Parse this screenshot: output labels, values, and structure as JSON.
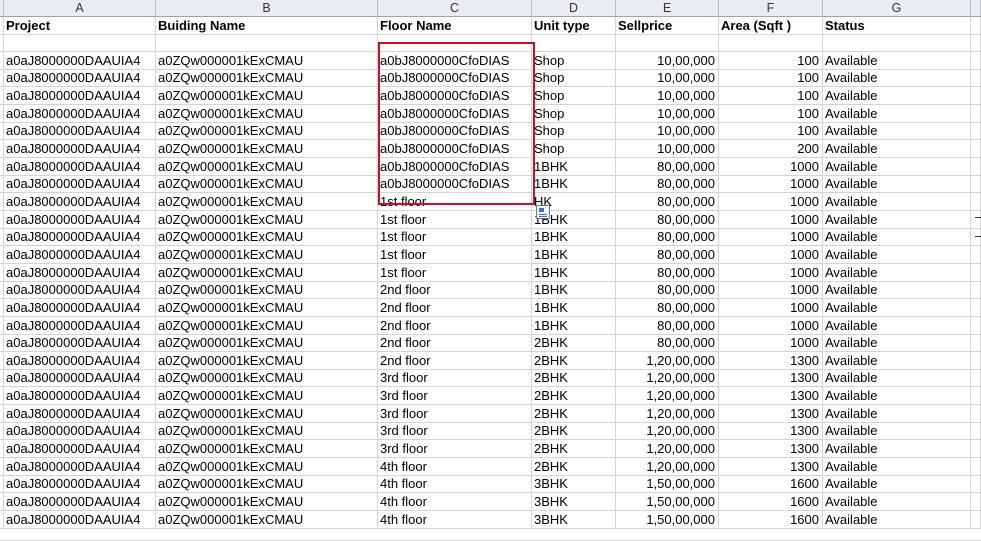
{
  "columns": [
    "A",
    "B",
    "C",
    "D",
    "E",
    "F",
    "G"
  ],
  "headers": [
    "Project",
    "Buiding Name",
    "Floor Name",
    "Unit type",
    "Sellprice",
    "Area (Sqft )",
    "Status"
  ],
  "rows": [
    [
      "a0aJ8000000DAAUIA4",
      "a0ZQw000001kExCMAU",
      "a0bJ8000000CfoDIAS",
      "Shop",
      "10,00,000",
      "100",
      "Available"
    ],
    [
      "a0aJ8000000DAAUIA4",
      "a0ZQw000001kExCMAU",
      "a0bJ8000000CfoDIAS",
      "Shop",
      "10,00,000",
      "100",
      "Available"
    ],
    [
      "a0aJ8000000DAAUIA4",
      "a0ZQw000001kExCMAU",
      "a0bJ8000000CfoDIAS",
      "Shop",
      "10,00,000",
      "100",
      "Available"
    ],
    [
      "a0aJ8000000DAAUIA4",
      "a0ZQw000001kExCMAU",
      "a0bJ8000000CfoDIAS",
      "Shop",
      "10,00,000",
      "100",
      "Available"
    ],
    [
      "a0aJ8000000DAAUIA4",
      "a0ZQw000001kExCMAU",
      "a0bJ8000000CfoDIAS",
      "Shop",
      "10,00,000",
      "100",
      "Available"
    ],
    [
      "a0aJ8000000DAAUIA4",
      "a0ZQw000001kExCMAU",
      "a0bJ8000000CfoDIAS",
      "Shop",
      "10,00,000",
      "200",
      "Available"
    ],
    [
      "a0aJ8000000DAAUIA4",
      "a0ZQw000001kExCMAU",
      "a0bJ8000000CfoDIAS",
      "1BHK",
      "80,00,000",
      "1000",
      "Available"
    ],
    [
      "a0aJ8000000DAAUIA4",
      "a0ZQw000001kExCMAU",
      "a0bJ8000000CfoDIAS",
      "1BHK",
      "80,00,000",
      "1000",
      "Available"
    ],
    [
      "a0aJ8000000DAAUIA4",
      "a0ZQw000001kExCMAU",
      "1st floor",
      "HK",
      "80,00,000",
      "1000",
      "Available"
    ],
    [
      "a0aJ8000000DAAUIA4",
      "a0ZQw000001kExCMAU",
      "1st floor",
      "1BHK",
      "80,00,000",
      "1000",
      "Available"
    ],
    [
      "a0aJ8000000DAAUIA4",
      "a0ZQw000001kExCMAU",
      "1st floor",
      "1BHK",
      "80,00,000",
      "1000",
      "Available"
    ],
    [
      "a0aJ8000000DAAUIA4",
      "a0ZQw000001kExCMAU",
      "1st floor",
      "1BHK",
      "80,00,000",
      "1000",
      "Available"
    ],
    [
      "a0aJ8000000DAAUIA4",
      "a0ZQw000001kExCMAU",
      "1st floor",
      "1BHK",
      "80,00,000",
      "1000",
      "Available"
    ],
    [
      "a0aJ8000000DAAUIA4",
      "a0ZQw000001kExCMAU",
      "2nd floor",
      "1BHK",
      "80,00,000",
      "1000",
      "Available"
    ],
    [
      "a0aJ8000000DAAUIA4",
      "a0ZQw000001kExCMAU",
      "2nd floor",
      "1BHK",
      "80,00,000",
      "1000",
      "Available"
    ],
    [
      "a0aJ8000000DAAUIA4",
      "a0ZQw000001kExCMAU",
      "2nd floor",
      "1BHK",
      "80,00,000",
      "1000",
      "Available"
    ],
    [
      "a0aJ8000000DAAUIA4",
      "a0ZQw000001kExCMAU",
      "2nd floor",
      "2BHK",
      "80,00,000",
      "1000",
      "Available"
    ],
    [
      "a0aJ8000000DAAUIA4",
      "a0ZQw000001kExCMAU",
      "2nd floor",
      "2BHK",
      "1,20,00,000",
      "1300",
      "Available"
    ],
    [
      "a0aJ8000000DAAUIA4",
      "a0ZQw000001kExCMAU",
      "3rd floor",
      "2BHK",
      "1,20,00,000",
      "1300",
      "Available"
    ],
    [
      "a0aJ8000000DAAUIA4",
      "a0ZQw000001kExCMAU",
      "3rd floor",
      "2BHK",
      "1,20,00,000",
      "1300",
      "Available"
    ],
    [
      "a0aJ8000000DAAUIA4",
      "a0ZQw000001kExCMAU",
      "3rd floor",
      "2BHK",
      "1,20,00,000",
      "1300",
      "Available"
    ],
    [
      "a0aJ8000000DAAUIA4",
      "a0ZQw000001kExCMAU",
      "3rd floor",
      "2BHK",
      "1,20,00,000",
      "1300",
      "Available"
    ],
    [
      "a0aJ8000000DAAUIA4",
      "a0ZQw000001kExCMAU",
      "3rd floor",
      "2BHK",
      "1,20,00,000",
      "1300",
      "Available"
    ],
    [
      "a0aJ8000000DAAUIA4",
      "a0ZQw000001kExCMAU",
      "4th floor",
      "2BHK",
      "1,20,00,000",
      "1300",
      "Available"
    ],
    [
      "a0aJ8000000DAAUIA4",
      "a0ZQw000001kExCMAU",
      "4th floor",
      "3BHK",
      "1,50,00,000",
      "1600",
      "Available"
    ],
    [
      "a0aJ8000000DAAUIA4",
      "a0ZQw000001kExCMAU",
      "4th floor",
      "3BHK",
      "1,50,00,000",
      "1600",
      "Available"
    ],
    [
      "a0aJ8000000DAAUIA4",
      "a0ZQw000001kExCMAU",
      "4th floor",
      "3BHK",
      "1,50,00,000",
      "1600",
      "Available"
    ]
  ],
  "numeric_columns": [
    4,
    5
  ],
  "highlight_color": "#c8102e",
  "icons": {
    "paste_options": "paste-options-icon"
  }
}
